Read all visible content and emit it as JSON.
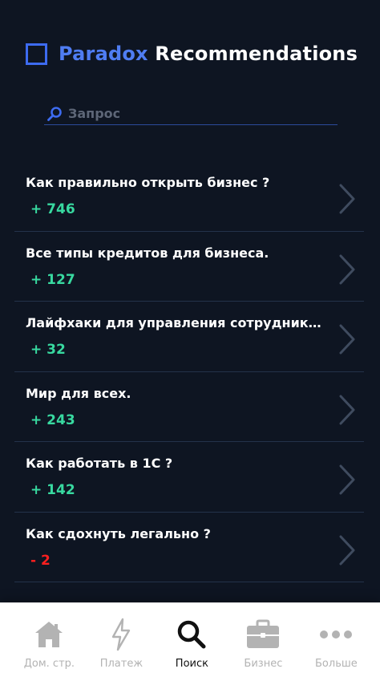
{
  "header": {
    "brand": "Paradox",
    "title": "Recommendations",
    "accent_color": "#4f7df3"
  },
  "search": {
    "placeholder": "Запрос",
    "value": "",
    "icon": "search-icon"
  },
  "items": [
    {
      "title": "Как правильно открыть бизнес ?",
      "count": "+ 746",
      "count_color": "#38d9a0"
    },
    {
      "title": "Все типы кредитов для бизнеса.",
      "count": "+ 127",
      "count_color": "#38d9a0"
    },
    {
      "title": "Лайфхаки для управления сотрудниками",
      "count": "+ 32",
      "count_color": "#38d9a0"
    },
    {
      "title": "Мир для всех.",
      "count": "+ 243",
      "count_color": "#38d9a0"
    },
    {
      "title": "Как работать в 1С ?",
      "count": "+ 142",
      "count_color": "#38d9a0"
    },
    {
      "title": "Как сдохнуть легально ?",
      "count": "- 2",
      "count_color": "#ff1f1f"
    }
  ],
  "tabs": [
    {
      "label": "Дом. стр.",
      "icon": "home-icon",
      "active": false
    },
    {
      "label": "Платеж",
      "icon": "lightning-icon",
      "active": false
    },
    {
      "label": "Поиск",
      "icon": "search-icon",
      "active": true
    },
    {
      "label": "Бизнес",
      "icon": "briefcase-icon",
      "active": false
    },
    {
      "label": "Больше",
      "icon": "more-icon",
      "active": false
    }
  ]
}
